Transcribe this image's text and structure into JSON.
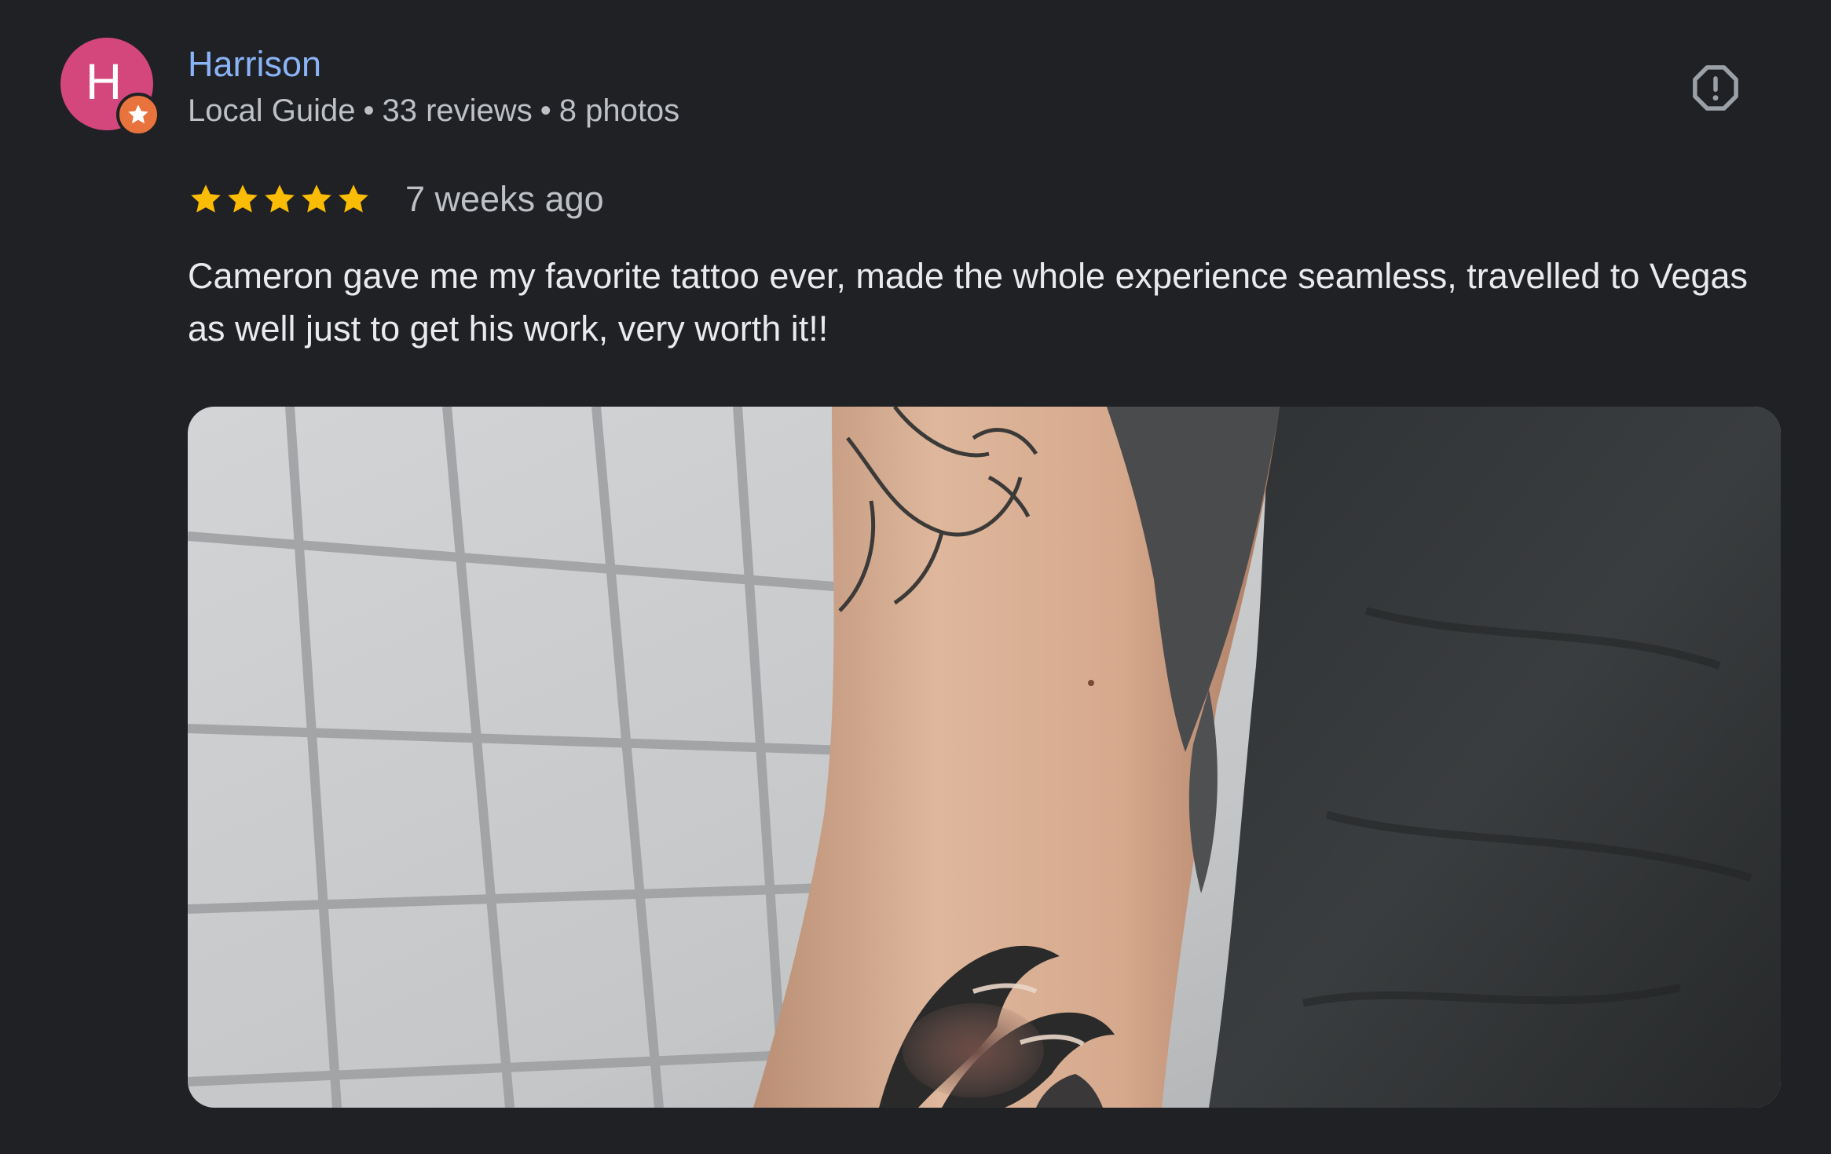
{
  "review": {
    "reviewer": {
      "avatar_letter": "H",
      "avatar_color": "#d4477d",
      "badge_icon": "local-guide-star-icon",
      "badge_color": "#e8733d",
      "name": "Harrison",
      "role": "Local Guide",
      "reviews_count": "33 reviews",
      "photos_count": "8 photos",
      "separator": "•"
    },
    "report_icon": "report-flag-icon",
    "rating": 5,
    "rating_max": 5,
    "star_color": "#fbbc04",
    "date": "7 weeks ago",
    "text": "Cameron gave me my favorite tattoo ever, made the whole experience seamless, travelled to Vegas as well just to get his work, very worth it!!",
    "photo": {
      "subject": "tattooed-arm-photo"
    }
  },
  "colors": {
    "background": "#202124",
    "name_link": "#8ab4f8",
    "secondary_text": "#bdc1c6",
    "primary_text": "#e8eaed"
  }
}
